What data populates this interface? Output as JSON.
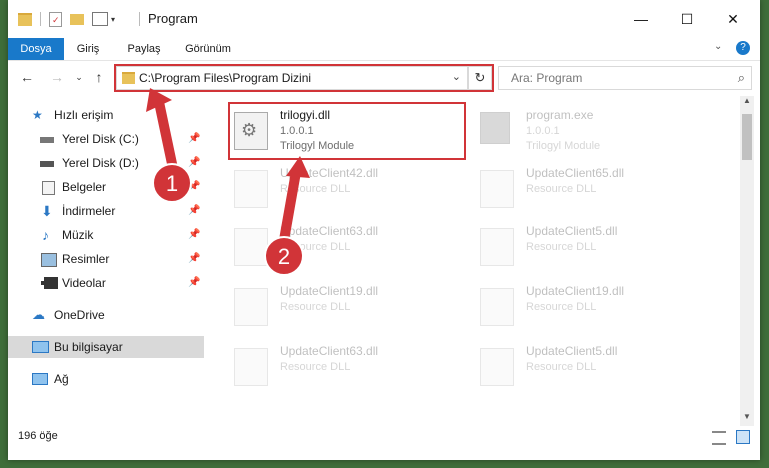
{
  "window": {
    "title": "Program",
    "controls": {
      "minimize": "—",
      "maximize": "☐",
      "close": "✕"
    }
  },
  "ribbon": {
    "tabs": [
      "Dosya",
      "Giriş",
      "Paylaş",
      "Görünüm"
    ],
    "active_tab": "Dosya",
    "expand_icon": "chevron-down-icon",
    "help_icon": "help-icon"
  },
  "nav": {
    "address": "C:\\Program Files\\Program Dizini",
    "search_placeholder": "Ara: Program"
  },
  "sidebar": {
    "items": [
      {
        "label": "Hızlı erişim",
        "icon": "star-icon"
      },
      {
        "label": "Yerel Disk (C:)",
        "icon": "drive-icon",
        "pinned": true
      },
      {
        "label": "Yerel Disk (D:)",
        "icon": "drive-icon",
        "pinned": true
      },
      {
        "label": "Belgeler",
        "icon": "documents-icon",
        "pinned": true
      },
      {
        "label": "İndirmeler",
        "icon": "download-icon",
        "pinned": true
      },
      {
        "label": "Müzik",
        "icon": "music-icon",
        "pinned": true
      },
      {
        "label": "Resimler",
        "icon": "pictures-icon",
        "pinned": true
      },
      {
        "label": "Videolar",
        "icon": "videos-icon",
        "pinned": true
      },
      {
        "label": "OneDrive",
        "icon": "cloud-icon"
      },
      {
        "label": "Bu bilgisayar",
        "icon": "computer-icon",
        "selected": true
      },
      {
        "label": "Ağ",
        "icon": "network-icon"
      }
    ]
  },
  "files": [
    {
      "name": "trilogyi.dll",
      "version": "1.0.0.1",
      "desc": "Trilogyl Module",
      "highlighted": true
    },
    {
      "name": "program.exe",
      "version": "1.0.0.1",
      "desc": "Trilogyl Module"
    },
    {
      "name": "UpdateClient42.dll",
      "desc": "Resource DLL"
    },
    {
      "name": "UpdateClient65.dll",
      "desc": "Resource DLL"
    },
    {
      "name": "UpdateClient63.dll",
      "desc": "Resource DLL"
    },
    {
      "name": "UpdateClient5.dll",
      "desc": "Resource DLL"
    },
    {
      "name": "UpdateClient19.dll",
      "desc": "Resource DLL"
    },
    {
      "name": "UpdateClient19.dll",
      "desc": "Resource DLL"
    },
    {
      "name": "UpdateClient63.dll",
      "desc": "Resource DLL"
    },
    {
      "name": "UpdateClient5.dll",
      "desc": "Resource DLL"
    }
  ],
  "status": {
    "item_count": "196 öğe"
  },
  "annotations": {
    "step1": "1",
    "step2": "2",
    "color": "#d13438"
  }
}
